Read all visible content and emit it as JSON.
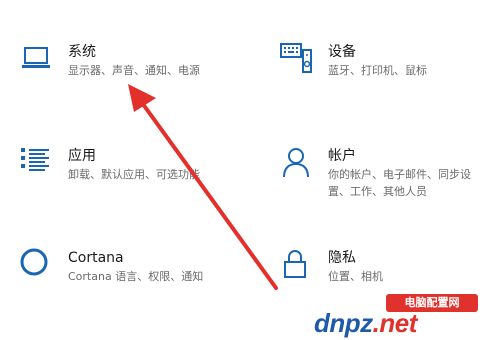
{
  "settings": {
    "system": {
      "title": "系统",
      "desc": "显示器、声音、通知、电源",
      "icon": "laptop-icon"
    },
    "devices": {
      "title": "设备",
      "desc": "蓝牙、打印机、鼠标",
      "icon": "keyboard-speaker-icon"
    },
    "apps": {
      "title": "应用",
      "desc": "卸载、默认应用、可选功能",
      "icon": "app-list-icon"
    },
    "accounts": {
      "title": "帐户",
      "desc": "你的帐户、电子邮件、同步设",
      "desc2": "置、工作、其他人员",
      "icon": "person-icon"
    },
    "cortana": {
      "title": "Cortana",
      "desc": "Cortana 语言、权限、通知",
      "icon": "cortana-circle-icon"
    },
    "privacy": {
      "title": "隐私",
      "desc": "位置、相机",
      "icon": "lock-icon"
    }
  },
  "colors": {
    "icon_accent": "#1a66b3",
    "arrow": "#e3302b"
  },
  "watermark": {
    "badge": "电脑配置网",
    "logo_left": "dnpz",
    "logo_right": ".net"
  }
}
